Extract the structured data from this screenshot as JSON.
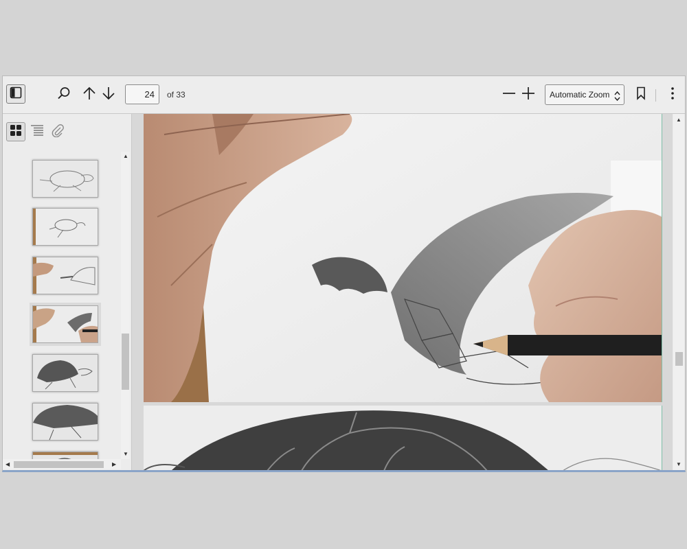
{
  "toolbar": {
    "page_number": "24",
    "page_count_label": "of 33",
    "zoom_label": "Automatic Zoom",
    "icons": [
      "sidebar-toggle-icon",
      "search-icon",
      "arrow-up-icon",
      "arrow-down-icon",
      "zoom-out-icon",
      "zoom-in-icon",
      "bookmark-icon",
      "more-vertical-icon"
    ]
  },
  "sidebar": {
    "tabs": [
      "thumbnails-icon",
      "outline-icon",
      "attachments-icon"
    ],
    "active_tab": "thumbnails-icon",
    "thumbnails": [
      {
        "label": "page-20"
      },
      {
        "label": "page-21"
      },
      {
        "label": "page-22"
      },
      {
        "label": "page-23"
      },
      {
        "label": "page-24",
        "selected": true
      },
      {
        "label": "page-25"
      },
      {
        "label": "page-26"
      }
    ]
  },
  "colors": {
    "accent": "#8aa4c8",
    "toolbar_bg": "#ededed",
    "page_bg": "#f2f2f2"
  }
}
